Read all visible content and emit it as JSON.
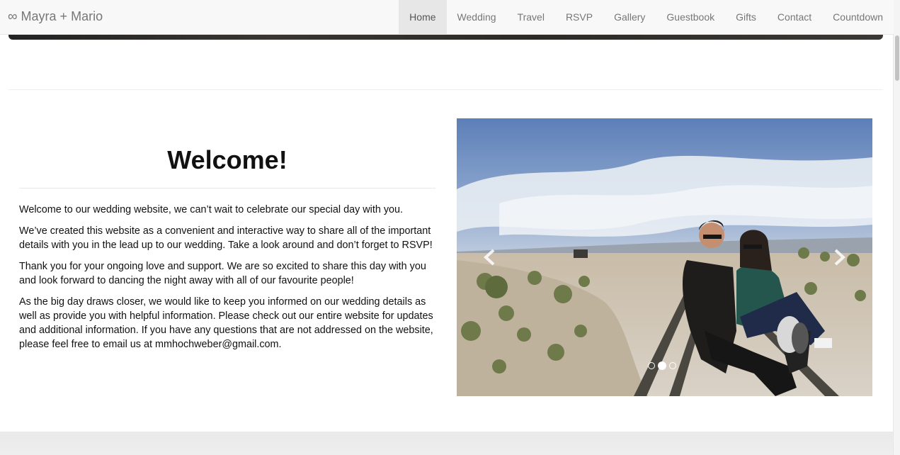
{
  "nav": {
    "brand_icon": "infinity-icon",
    "brand_symbol": "∞",
    "brand": "Mayra + Mario",
    "links": [
      "Home",
      "Wedding",
      "Travel",
      "RSVP",
      "Gallery",
      "Guestbook",
      "Gifts",
      "Contact",
      "Countdown"
    ],
    "active": "Home"
  },
  "welcome": {
    "title": "Welcome!",
    "paragraphs": [
      "Welcome to our wedding website, we can’t wait to celebrate our special day with you.",
      "We’ve created this website as a convenient and interactive way to share all of the important details with you in the lead up to our wedding. Take a look around and don’t forget to RSVP!",
      "Thank you for your ongoing love and support. We are so excited to share this day with you and look forward to dancing the night away with all of our favourite people!",
      "As the big day draws closer, we would like to keep you informed on our wedding details as well as provide you with helpful information. Please check out our entire website for updates and additional information. If you have any questions that are not addressed on the website, please feel free to email us at mmhochweber@gmail.com."
    ]
  },
  "carousel": {
    "prev_icon": "chevron-left-icon",
    "next_icon": "chevron-right-icon",
    "slide_count": 3,
    "active_slide": 2
  }
}
